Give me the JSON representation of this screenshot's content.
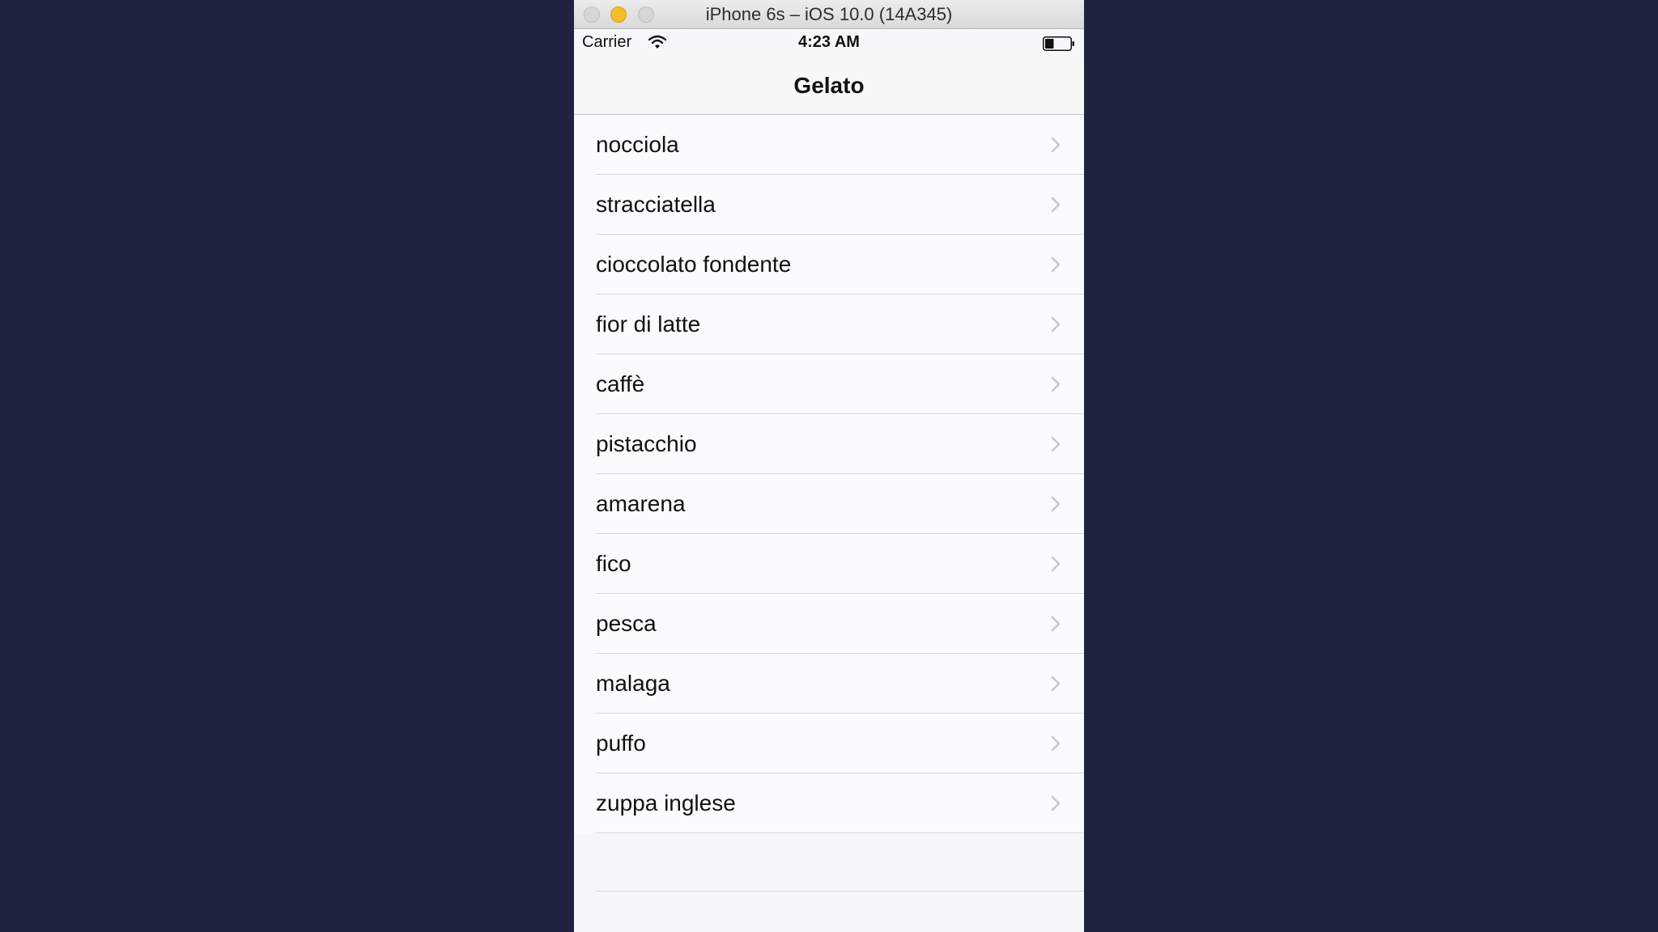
{
  "window": {
    "title": "iPhone 6s – iOS 10.0 (14A345)"
  },
  "status_bar": {
    "carrier": "Carrier",
    "time": "4:23 AM",
    "wifi_icon": "wifi-icon",
    "battery_icon": "battery-icon",
    "battery_level": 0.35
  },
  "nav": {
    "title": "Gelato"
  },
  "list": {
    "items": [
      "nocciola",
      "stracciatella",
      "cioccolato fondente",
      "fior di latte",
      "caffè",
      "pistacchio",
      "amarena",
      "fico",
      "pesca",
      "malaga",
      "puffo",
      "zuppa inglese"
    ],
    "accessory_icon": "chevron-right-icon"
  },
  "colors": {
    "desktop": "#1f2340",
    "minimize_button": "#f5bd2a",
    "chevron": "#c7c7cc"
  }
}
